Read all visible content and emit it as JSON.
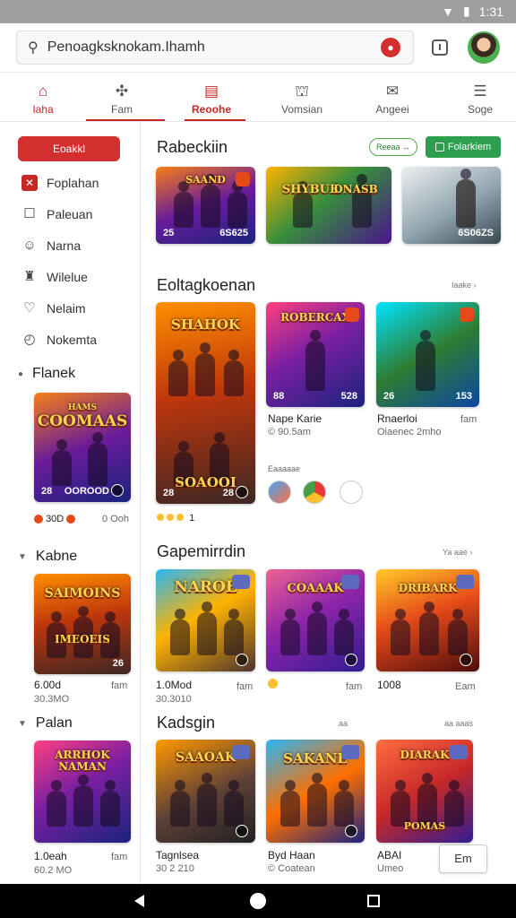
{
  "status": {
    "time": "1:31"
  },
  "search": {
    "value": "Penoagksknokam.Ihamh"
  },
  "nav": {
    "tabs": [
      {
        "label": "Iaha",
        "icon": "home-icon"
      },
      {
        "label": "Fam",
        "icon": "gamepad-icon"
      },
      {
        "label": "Reoohe",
        "icon": "list-icon"
      },
      {
        "label": "Vomsian",
        "icon": "school-icon"
      },
      {
        "label": "Angeei",
        "icon": "mail-icon"
      },
      {
        "label": "Soge",
        "icon": "menu-icon"
      }
    ],
    "active_index": 2
  },
  "sidebar": {
    "button_label": "Eoakkl",
    "items": [
      {
        "label": "Foplahan",
        "icon": "gamepad-icon"
      },
      {
        "label": "Paleuan",
        "icon": "square-icon"
      },
      {
        "label": "Narna",
        "icon": "smiley-icon"
      },
      {
        "label": "Wilelue",
        "icon": "trophy-icon"
      },
      {
        "label": "Nelaim",
        "icon": "heart-icon"
      },
      {
        "label": "Nokemta",
        "icon": "clock-icon"
      }
    ],
    "sections": [
      {
        "title": "Flanek",
        "card_title": "COOMAAS",
        "card_top": "HAMS",
        "card_bl": "28",
        "card_mid": "OOROOD",
        "meta_left": "30D",
        "meta_right": "0 Ooh"
      },
      {
        "title": "Kabne",
        "card_title": "SAIMOINS",
        "card_sub": "IMEOEIS",
        "card_br": "26",
        "meta1": "6.00d",
        "meta1r": "fam",
        "meta2": "30.3MO"
      },
      {
        "title": "Palan",
        "card_title": "ARRHOK NAMAN",
        "meta1": "1.0eah",
        "meta1r": "fam",
        "meta2": "60.2 MO"
      }
    ]
  },
  "main": {
    "section1": {
      "title": "Rabeckiin",
      "outline_label": "Reeaa ↔",
      "button_label": "Folarkiem",
      "cards": [
        {
          "title": "SAAND",
          "bl": "25",
          "br": "6S625"
        },
        {
          "title": "SHYBUK",
          "title2": "DNASB"
        },
        {
          "title": "",
          "br": "6S06ZS"
        }
      ]
    },
    "section2": {
      "title": "Eoltagkoenan",
      "link": "Iaake ›",
      "big_card": {
        "title": "SHAHOK",
        "title2": "SOAOOI",
        "bl": "28",
        "br": "28"
      },
      "cards": [
        {
          "title": "ROBERCAX",
          "bl": "88",
          "br": "528",
          "meta1": "Nape Karie",
          "meta2": "© 90.5am"
        },
        {
          "title": "",
          "bl": "26",
          "br": "153",
          "meta1": "Rnaerloi",
          "meta1r": "fam",
          "meta2": "Oiaenec 2mho"
        }
      ],
      "small_label": "Eaaaaae",
      "small_icons": [
        "game-icon",
        "chrome-icon",
        "timer-icon"
      ],
      "dots_count": "1"
    },
    "section3": {
      "title": "Gapemirrdin",
      "link": "Ya aae ›",
      "cards": [
        {
          "title": "NAROE",
          "meta1": "1.0Mod",
          "meta1r": "fam",
          "meta2": "30.3010"
        },
        {
          "title": "COAAAK",
          "meta1r": "fam"
        },
        {
          "title": "DRIBARK",
          "meta1": "1008",
          "meta1r": "Eam"
        }
      ]
    },
    "section4": {
      "title": "Kadsgin",
      "link1": "aa",
      "link2": "aa aaas",
      "cards": [
        {
          "title": "SAAOAK",
          "meta1": "Tagnlsea",
          "meta2": "30 2 210"
        },
        {
          "title": "SAKANE",
          "meta1": "Byd Haan",
          "meta2": "© Coatean"
        },
        {
          "title": "DIARAK",
          "title2": "POMAS",
          "meta1": "ABAI",
          "meta2": "Umeo"
        }
      ],
      "float_label": "Em"
    }
  }
}
